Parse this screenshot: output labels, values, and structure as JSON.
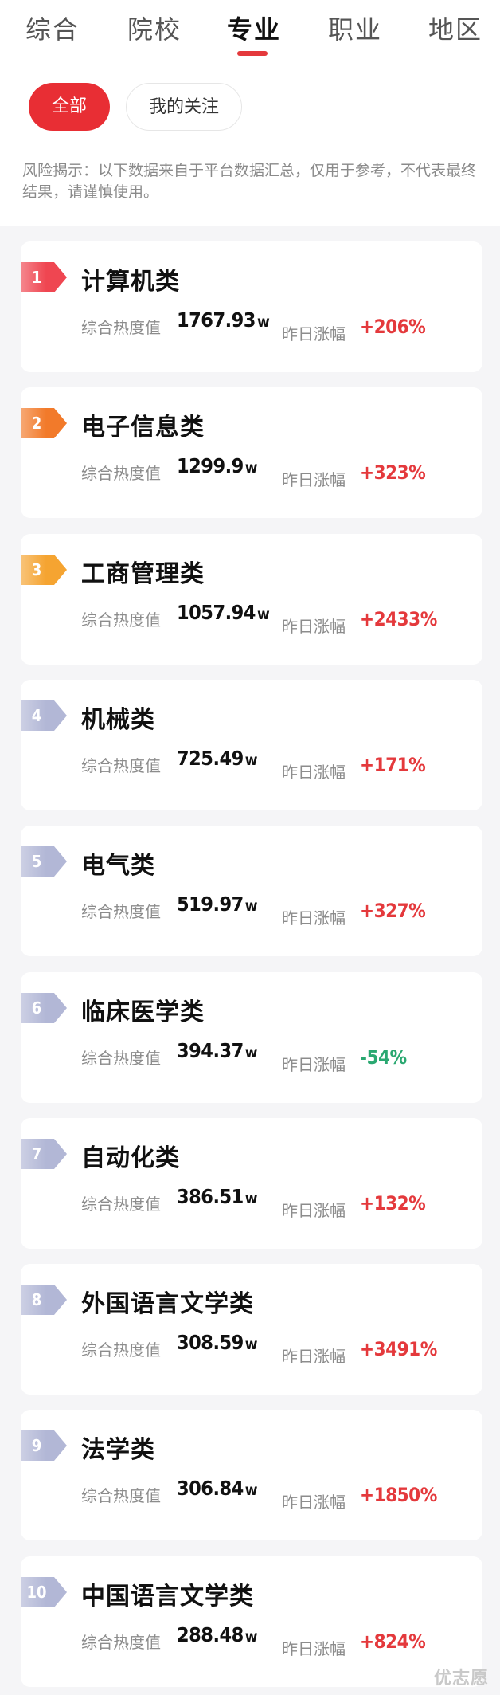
{
  "tabs": [
    {
      "label": "综合",
      "active": false
    },
    {
      "label": "院校",
      "active": false
    },
    {
      "label": "专业",
      "active": true
    },
    {
      "label": "职业",
      "active": false
    },
    {
      "label": "地区",
      "active": false
    }
  ],
  "filters": {
    "all": "全部",
    "following": "我的关注"
  },
  "risk_notice": "风险揭示：以下数据来自于平台数据汇总，仅用于参考，不代表最终结果，请谨慎使用。",
  "heat_label": "综合热度值",
  "change_label": "昨日涨幅",
  "heat_unit": "w",
  "rank_colors": {
    "top1": "#ef4651",
    "top2": "#f27a2a",
    "top3": "#f5a431",
    "other": "#b2b7d6"
  },
  "change_colors": {
    "up": "#e4393c",
    "down": "#2aa871"
  },
  "items": [
    {
      "rank": "1",
      "name": "计算机类",
      "heat": "1767.93",
      "change": "+206%",
      "trend": "up"
    },
    {
      "rank": "2",
      "name": "电子信息类",
      "heat": "1299.9",
      "change": "+323%",
      "trend": "up"
    },
    {
      "rank": "3",
      "name": "工商管理类",
      "heat": "1057.94",
      "change": "+2433%",
      "trend": "up"
    },
    {
      "rank": "4",
      "name": "机械类",
      "heat": "725.49",
      "change": "+171%",
      "trend": "up"
    },
    {
      "rank": "5",
      "name": "电气类",
      "heat": "519.97",
      "change": "+327%",
      "trend": "up"
    },
    {
      "rank": "6",
      "name": "临床医学类",
      "heat": "394.37",
      "change": "-54%",
      "trend": "down"
    },
    {
      "rank": "7",
      "name": "自动化类",
      "heat": "386.51",
      "change": "+132%",
      "trend": "up"
    },
    {
      "rank": "8",
      "name": "外国语言文学类",
      "heat": "308.59",
      "change": "+3491%",
      "trend": "up"
    },
    {
      "rank": "9",
      "name": "法学类",
      "heat": "306.84",
      "change": "+1850%",
      "trend": "up"
    },
    {
      "rank": "10",
      "name": "中国语言文学类",
      "heat": "288.48",
      "change": "+824%",
      "trend": "up"
    }
  ],
  "watermark": "优志愿"
}
